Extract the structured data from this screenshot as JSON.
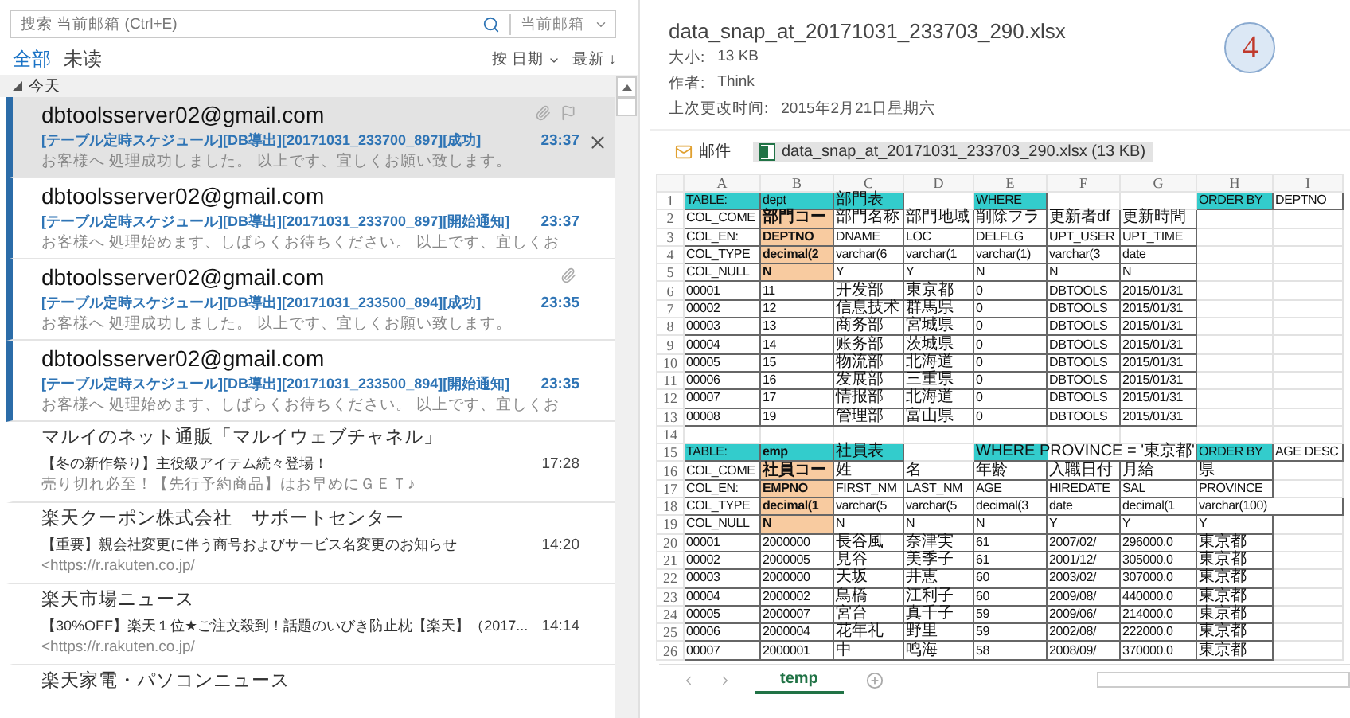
{
  "search": {
    "placeholder": "搜索 当前邮箱 (Ctrl+E)",
    "scope": "当前邮箱"
  },
  "filters": [
    {
      "label": "全部",
      "selected": true
    },
    {
      "label": "未读",
      "selected": false
    }
  ],
  "sort": {
    "by": "按 日期",
    "order": "最新 ↓"
  },
  "group": {
    "label": "今天",
    "expanded": true
  },
  "messages": [
    {
      "sender": "dbtoolsserver02@gmail.com",
      "subject": "[テーブル定時スケジュール][DB導出][20171031_233700_897][成功]",
      "preview": "お客様へ  処理成功しました。  以上です、宜しくお願い致します。",
      "time": "23:37",
      "unread": true,
      "selected": true,
      "attachment": true
    },
    {
      "sender": "dbtoolsserver02@gmail.com",
      "subject": "[テーブル定時スケジュール][DB導出][20171031_233700_897][開始通知]",
      "preview": "お客様へ  処理始めます、しばらくお待ちください。  以上です、宜しくお",
      "time": "23:37",
      "unread": true,
      "selected": false,
      "attachment": false
    },
    {
      "sender": "dbtoolsserver02@gmail.com",
      "subject": "[テーブル定時スケジュール][DB導出][20171031_233500_894][成功]",
      "preview": "お客様へ  処理成功しました。  以上です、宜しくお願い致します。",
      "time": "23:35",
      "unread": true,
      "selected": false,
      "attachment": true
    },
    {
      "sender": "dbtoolsserver02@gmail.com",
      "subject": "[テーブル定時スケジュール][DB導出][20171031_233500_894][開始通知]",
      "preview": "お客様へ  処理始めます、しばらくお待ちください。  以上です、宜しくお",
      "time": "23:35",
      "unread": true,
      "selected": false,
      "attachment": false
    },
    {
      "sender": "マルイのネット通販「マルイウェブチャネル」",
      "subject": "【冬の新作祭り】主役級アイテム続々登場！",
      "preview": "売り切れ必至！【先行予約商品】はお早めにＧＥＴ♪",
      "time": "17:28",
      "unread": false,
      "selected": false,
      "attachment": false
    },
    {
      "sender": "楽天クーポン株式会社　サポートセンター",
      "subject": "【重要】親会社変更に伴う商号およびサービス名変更のお知らせ",
      "preview": "<https://r.rakuten.co.jp/",
      "time": "14:20",
      "unread": false,
      "selected": false,
      "attachment": false
    },
    {
      "sender": "楽天市場ニュース",
      "subject": "【30%OFF】楽天１位★ご注文殺到！話題のいびき防止枕【楽天】（2017...",
      "preview": "<https://r.rakuten.co.jp/",
      "time": "14:14",
      "unread": false,
      "selected": false,
      "attachment": false
    },
    {
      "sender": "楽天家電・パソコンニュース",
      "unread": false,
      "selected": false,
      "attachment": false
    }
  ],
  "preview": {
    "title": "data_snap_at_20171031_233703_290.xlsx",
    "size_label": "大小:",
    "size": "13 KB",
    "author_label": "作者:",
    "author": "Think",
    "modified_label": "上次更改时间:",
    "modified": "2015年2月21日星期六",
    "step_badge": "4",
    "attachments": [
      {
        "kind": "message",
        "label": "邮件",
        "selected": false
      },
      {
        "kind": "excel",
        "label": "data_snap_at_20171031_233703_290.xlsx (13 KB)",
        "selected": true
      }
    ]
  },
  "sheet": {
    "columns": [
      "A",
      "B",
      "C",
      "D",
      "E",
      "F",
      "G",
      "H",
      "I"
    ],
    "rows": [
      {
        "num": "1",
        "cells": [
          {
            "text": "TABLE:",
            "color": "#33cccc"
          },
          {
            "text": "dept",
            "color": "#33cccc"
          },
          {
            "text": "部門表",
            "color": "#33cccc"
          },
          null,
          {
            "text": "WHERE",
            "color": "#33cccc"
          },
          null,
          null,
          {
            "text": "ORDER BY",
            "color": "#33cccc"
          },
          "DEPTNO"
        ]
      },
      {
        "num": "2",
        "cells": [
          "COL_COME",
          {
            "text": "部門コー",
            "color": "#f8cba0"
          },
          "部門名称",
          "部門地域",
          "削除フラ",
          "更新者df",
          "更新時間",
          null,
          null
        ]
      },
      {
        "num": "3",
        "cells": [
          "COL_EN:",
          {
            "text": "DEPTNO",
            "color": "#f8cba0"
          },
          "DNAME",
          "LOC",
          "DELFLG",
          "UPT_USER",
          "UPT_TIME",
          null,
          null
        ]
      },
      {
        "num": "4",
        "cells": [
          "COL_TYPE",
          {
            "text": "decimal(2",
            "color": "#f8cba0"
          },
          "varchar(6",
          "varchar(1",
          "varchar(1)",
          "varchar(3",
          "date",
          null,
          null
        ]
      },
      {
        "num": "5",
        "cells": [
          "COL_NULL",
          {
            "text": "N",
            "color": "#f8cba0"
          },
          "Y",
          "Y",
          "N",
          "N",
          "N",
          null,
          null
        ]
      },
      {
        "num": "6",
        "cells": [
          "00001",
          "11",
          "开发部",
          "東京都",
          "0",
          "DBTOOLS",
          "2015/01/31",
          null,
          null
        ]
      },
      {
        "num": "7",
        "cells": [
          "00002",
          "12",
          "信息技术",
          "群馬県",
          "0",
          "DBTOOLS",
          "2015/01/31",
          null,
          null
        ]
      },
      {
        "num": "8",
        "cells": [
          "00003",
          "13",
          "商务部",
          "宮城県",
          "0",
          "DBTOOLS",
          "2015/01/31",
          null,
          null
        ]
      },
      {
        "num": "9",
        "cells": [
          "00004",
          "14",
          "账务部",
          "茨城県",
          "0",
          "DBTOOLS",
          "2015/01/31",
          null,
          null
        ]
      },
      {
        "num": "10",
        "cells": [
          "00005",
          "15",
          "物流部",
          "北海道",
          "0",
          "DBTOOLS",
          "2015/01/31",
          null,
          null
        ]
      },
      {
        "num": "11",
        "cells": [
          "00006",
          "16",
          "发展部",
          "三重県",
          "0",
          "DBTOOLS",
          "2015/01/31",
          null,
          null
        ]
      },
      {
        "num": "12",
        "cells": [
          "00007",
          "17",
          "情报部",
          "北海道",
          "0",
          "DBTOOLS",
          "2015/01/31",
          null,
          null
        ]
      },
      {
        "num": "13",
        "cells": [
          "00008",
          "19",
          "管理部",
          "富山県",
          "0",
          "DBTOOLS",
          "2015/01/31",
          null,
          null
        ]
      },
      {
        "num": "14",
        "cells": [
          null,
          null,
          null,
          null,
          null,
          null,
          null,
          null,
          null
        ]
      },
      {
        "num": "15",
        "cells": [
          {
            "text": "TABLE:",
            "color": "#33cccc"
          },
          {
            "text": "emp",
            "color": "#33cccc"
          },
          {
            "text": "社員表",
            "color": "#33cccc"
          },
          null,
          {
            "text": "WHERE PROVINCE = '東京都'",
            "color": "#33cccc",
            "colspan": 3
          },
          {
            "text": "ORDER BY",
            "color": "#33cccc"
          },
          "AGE DESC"
        ]
      },
      {
        "num": "16",
        "cells": [
          "COL_COME",
          {
            "text": "社員コー",
            "color": "#f8cba0"
          },
          "姓",
          "名",
          "年龄",
          "入職日付",
          "月給",
          "県",
          null
        ]
      },
      {
        "num": "17",
        "cells": [
          "COL_EN:",
          {
            "text": "EMPNO",
            "color": "#f8cba0"
          },
          "FIRST_NM",
          "LAST_NM",
          "AGE",
          "HIREDATE",
          "SAL",
          "PROVINCE",
          null
        ]
      },
      {
        "num": "18",
        "cells": [
          "COL_TYPE",
          {
            "text": "decimal(1",
            "color": "#f8cba0"
          },
          "varchar(5",
          "varchar(5",
          "decimal(3",
          "date",
          "decimal(1",
          {
            "text": "varchar(100)",
            "colspan": 2
          }
        ]
      },
      {
        "num": "19",
        "cells": [
          "COL_NULL",
          {
            "text": "N",
            "color": "#f8cba0"
          },
          "N",
          "N",
          "N",
          "Y",
          "Y",
          "Y",
          null
        ]
      },
      {
        "num": "20",
        "cells": [
          "00001",
          "2000000",
          "長谷風",
          "奈津実",
          "61",
          "2007/02/",
          "296000.0",
          "東京都",
          null
        ]
      },
      {
        "num": "21",
        "cells": [
          "00002",
          "2000005",
          "見谷",
          "美季子",
          "61",
          "2001/12/",
          "305000.0",
          "東京都",
          null
        ]
      },
      {
        "num": "22",
        "cells": [
          "00003",
          "2000000",
          "天坂",
          "井恵",
          "60",
          "2003/02/",
          "307000.0",
          "東京都",
          null
        ]
      },
      {
        "num": "23",
        "cells": [
          "00004",
          "2000002",
          "鳥橋",
          "江利子",
          "60",
          "2009/08/",
          "440000.0",
          "東京都",
          null
        ]
      },
      {
        "num": "24",
        "cells": [
          "00005",
          "2000007",
          "宮台",
          "真千子",
          "59",
          "2009/06/",
          "214000.0",
          "東京都",
          null
        ]
      },
      {
        "num": "25",
        "cells": [
          "00006",
          "2000004",
          "花年礼",
          "野里",
          "59",
          "2002/08/",
          "222000.0",
          "東京都",
          null
        ]
      },
      {
        "num": "26",
        "cells": [
          "00007",
          "2000001",
          "中",
          "鸣海",
          "58",
          "2008/09/",
          "370000.0",
          "東京都",
          null
        ]
      }
    ],
    "tabs": [
      {
        "label": "temp",
        "selected": true
      }
    ]
  }
}
